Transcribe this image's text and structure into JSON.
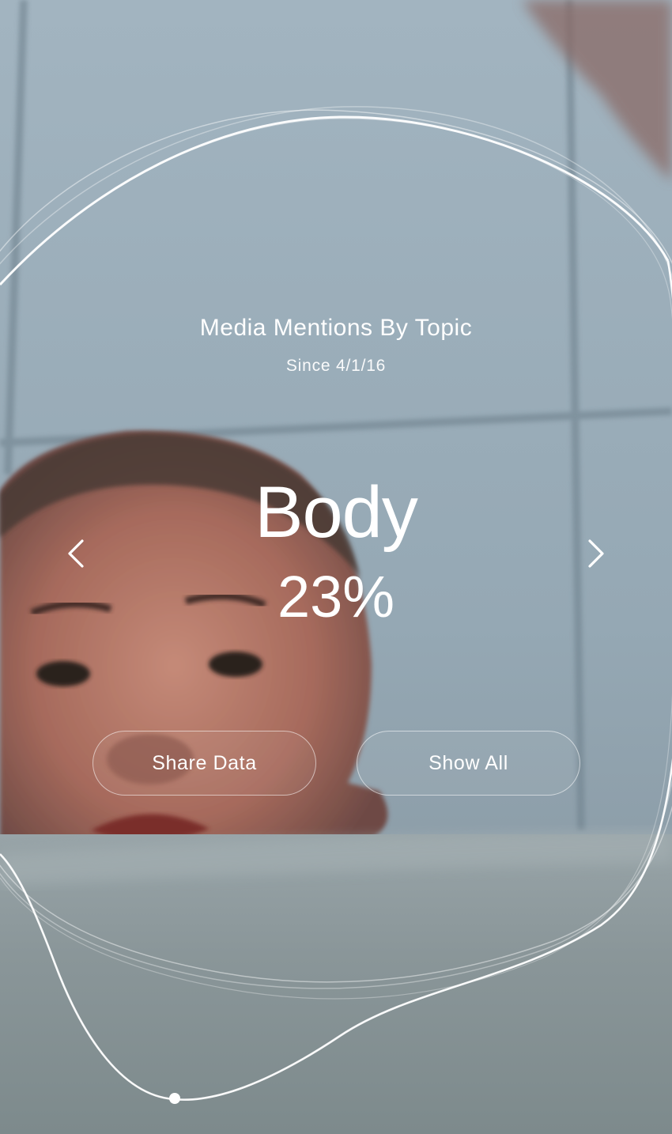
{
  "header": {
    "title": "Media Mentions By Topic",
    "subtitle": "Since 4/1/16"
  },
  "topic_card": {
    "topic": "Body",
    "percent": "23%"
  },
  "navigation": {
    "prev_icon": "chevron-left-icon",
    "next_icon": "chevron-right-icon"
  },
  "actions": {
    "share_label": "Share Data",
    "show_all_label": "Show All"
  },
  "colors": {
    "text": "#ffffff",
    "background_tint": "#93a7b4"
  }
}
